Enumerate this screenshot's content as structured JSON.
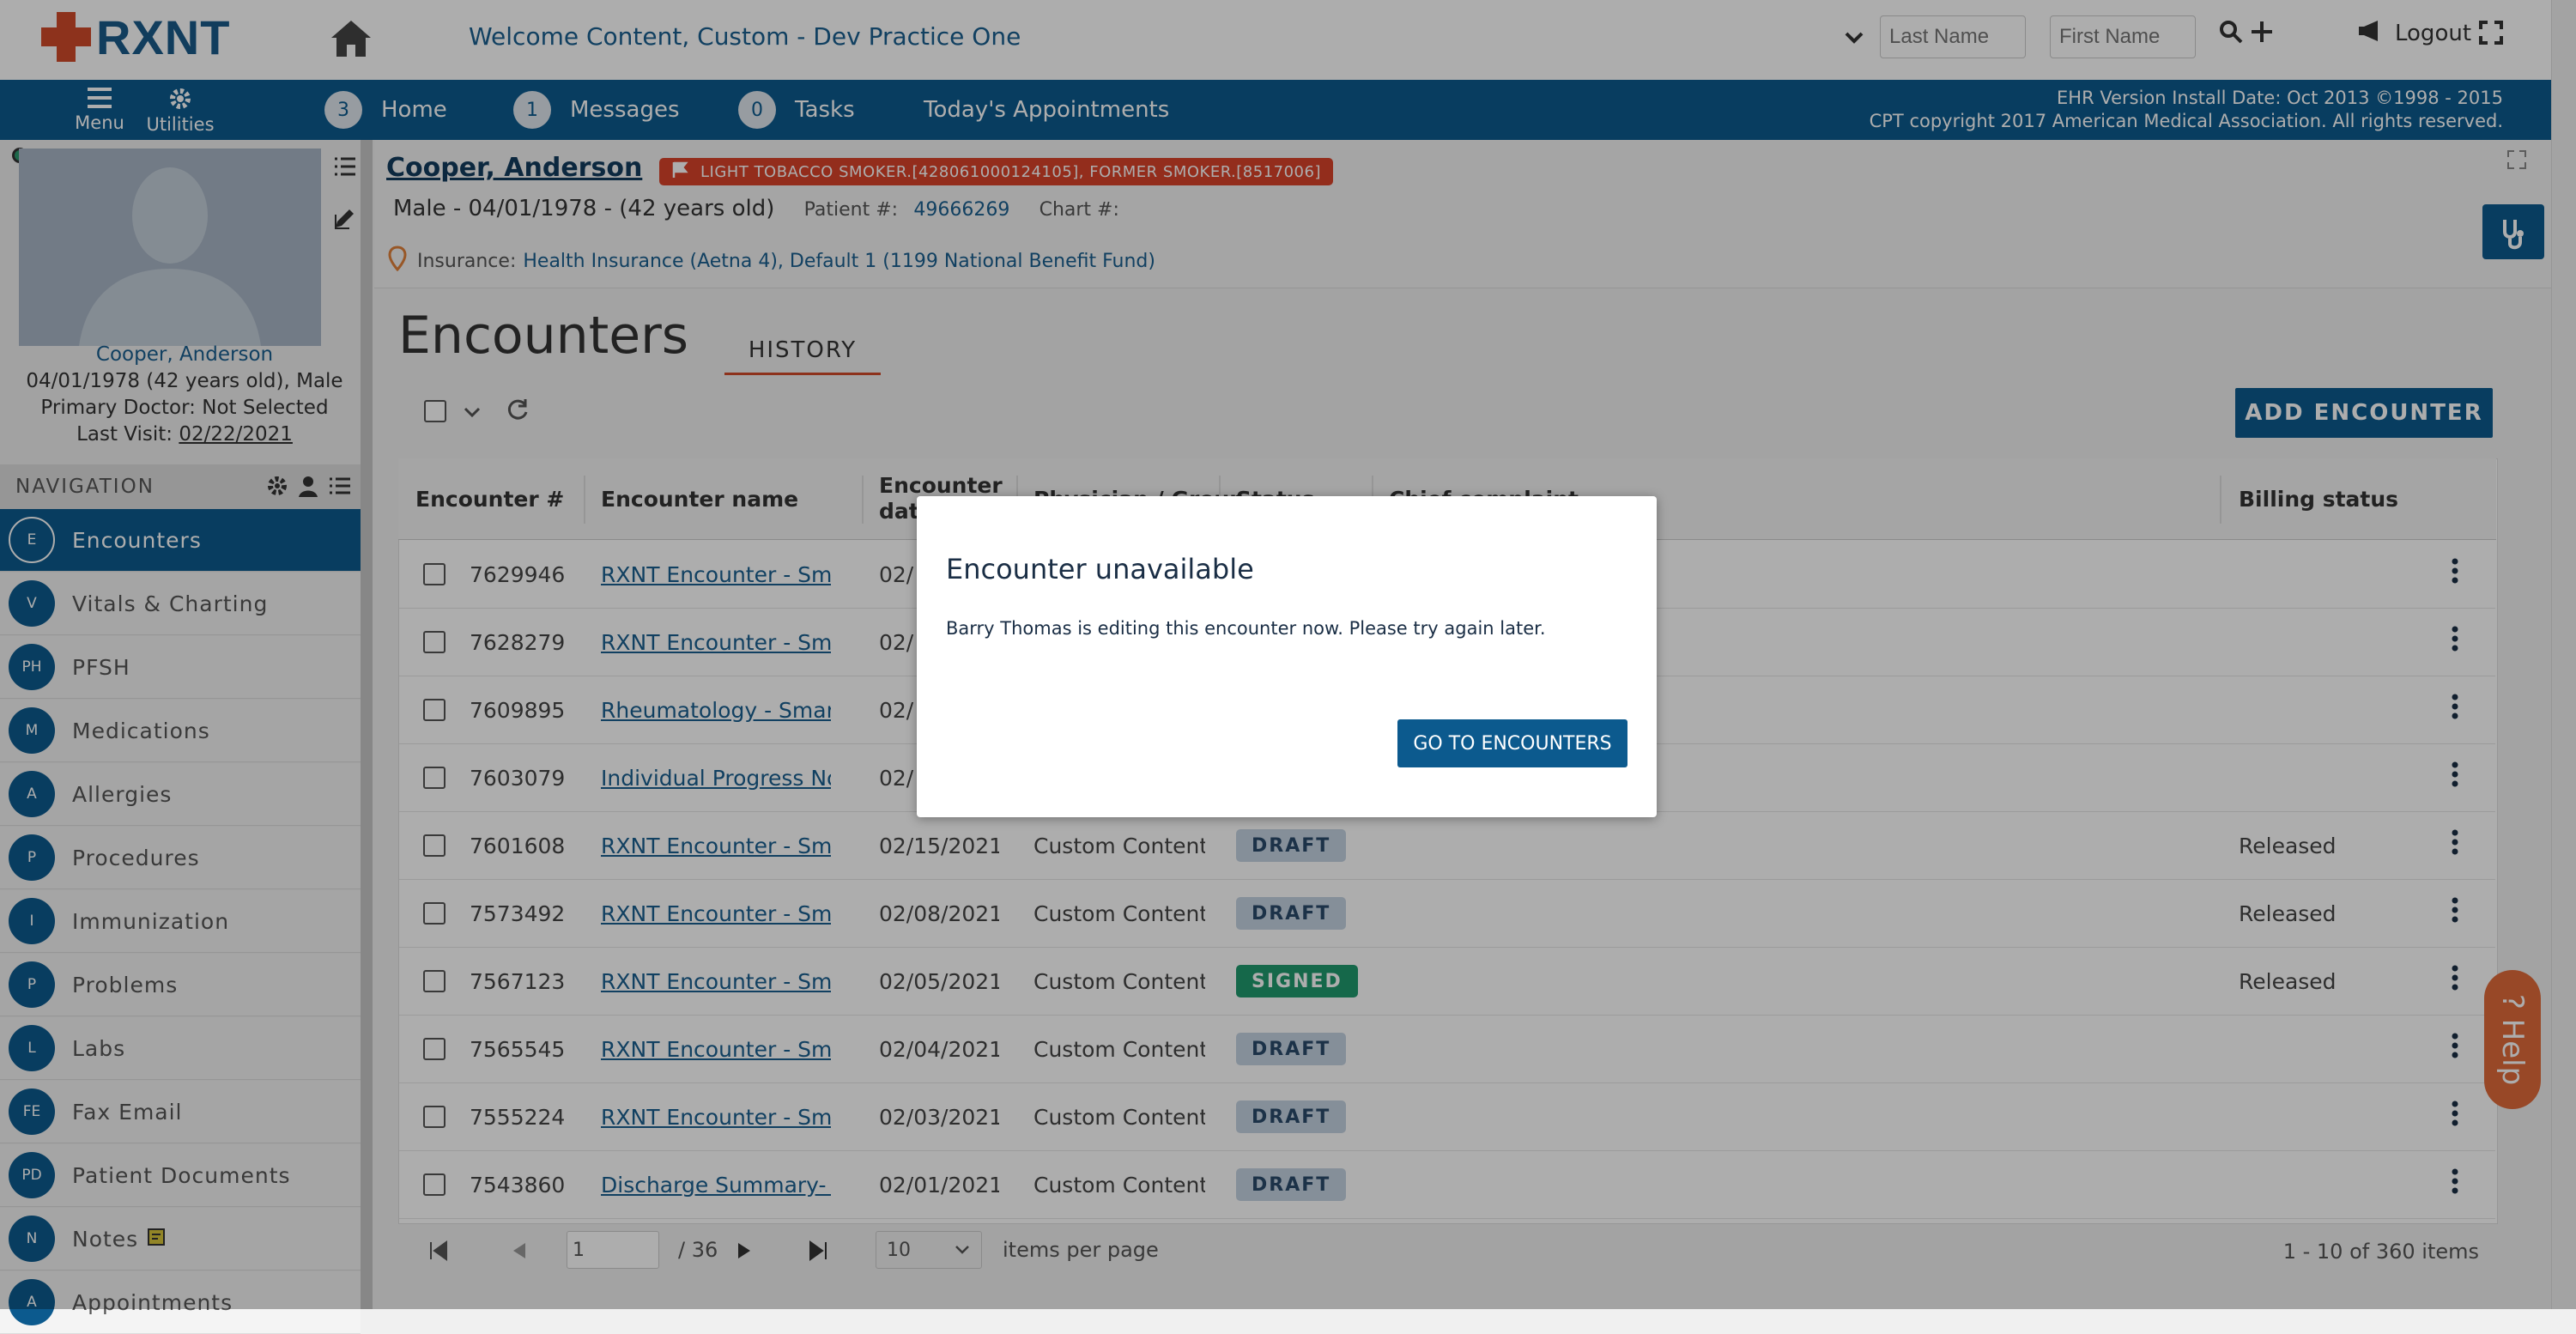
{
  "brand": {
    "name": "RXNT",
    "cross_color": "#d04a2a",
    "text_color": "#1a5a8a"
  },
  "header": {
    "welcome": "Welcome  Content, Custom - Dev Practice One",
    "last_name_placeholder": "Last Name",
    "first_name_placeholder": "First Name",
    "logout": "Logout"
  },
  "navbar": {
    "menu": "Menu",
    "utilities": "Utilities",
    "home_count": "3",
    "home": "Home",
    "messages_count": "1",
    "messages": "Messages",
    "tasks_count": "0",
    "tasks": "Tasks",
    "appointments": "Today's Appointments",
    "ehr_line1": "EHR Version Install Date: Oct 2013 ©1998 - 2015",
    "ehr_line2": "CPT copyright 2017 American Medical Association. All rights reserved."
  },
  "patient": {
    "name": "Cooper, Anderson",
    "dob_line": "04/01/1978 (42 years old), Male",
    "primary_doctor": "Primary Doctor: Not Selected",
    "last_visit_label": "Last Visit:",
    "last_visit": "02/22/2021",
    "header_name": "Cooper, Anderson",
    "flag": "LIGHT TOBACCO SMOKER.[428061000124105], FORMER SMOKER.[8517006]",
    "detail": "Male - 04/01/1978 - (42 years old)",
    "patient_num_label": "Patient #:",
    "patient_num": "49666269",
    "chart_label": "Chart #:",
    "insurance_label": "Insurance:",
    "insurance": "Health Insurance (Aetna 4), Default 1 (1199 National Benefit Fund)"
  },
  "navigation": {
    "title": "NAVIGATION",
    "items": [
      {
        "abbr": "E",
        "label": "Encounters"
      },
      {
        "abbr": "V",
        "label": "Vitals & Charting"
      },
      {
        "abbr": "PH",
        "label": "PFSH"
      },
      {
        "abbr": "M",
        "label": "Medications"
      },
      {
        "abbr": "A",
        "label": "Allergies"
      },
      {
        "abbr": "P",
        "label": "Procedures"
      },
      {
        "abbr": "I",
        "label": "Immunization"
      },
      {
        "abbr": "P",
        "label": "Problems"
      },
      {
        "abbr": "L",
        "label": "Labs"
      },
      {
        "abbr": "FE",
        "label": "Fax Email"
      },
      {
        "abbr": "PD",
        "label": "Patient Documents"
      },
      {
        "abbr": "N",
        "label": "Notes"
      },
      {
        "abbr": "A",
        "label": "Appointments"
      }
    ]
  },
  "main": {
    "title": "Encounters",
    "history_tab": "HISTORY",
    "add_button": "ADD ENCOUNTER",
    "columns": [
      "Encounter #",
      "Encounter name",
      "Encounter dat",
      "Physician / Group",
      "Status",
      "Chief complaint",
      "Billing status"
    ],
    "rows": [
      {
        "num": "7629946",
        "name": "RXNT Encounter - Smart For",
        "date": "02/",
        "group": "",
        "status": "",
        "billing": ""
      },
      {
        "num": "7628279",
        "name": "RXNT Encounter - Smart For",
        "date": "02/",
        "group": "",
        "status": "",
        "billing": ""
      },
      {
        "num": "7609895",
        "name": "Rheumatology - Smart Form",
        "date": "02/",
        "group": "",
        "status": "",
        "billing": ""
      },
      {
        "num": "7603079",
        "name": "Individual Progress Note - K",
        "date": "02/",
        "group": "",
        "status": "",
        "billing": ""
      },
      {
        "num": "7601608",
        "name": "RXNT Encounter - Smart For",
        "date": "02/15/2021",
        "group": "Custom Content",
        "status": "DRAFT",
        "billing": "Released"
      },
      {
        "num": "7573492",
        "name": "RXNT Encounter - Smart For",
        "date": "02/08/2021",
        "group": "Custom Content",
        "status": "DRAFT",
        "billing": "Released"
      },
      {
        "num": "7567123",
        "name": "RXNT Encounter - Smart For",
        "date": "02/05/2021",
        "group": "Custom Content",
        "status": "SIGNED",
        "billing": "Released"
      },
      {
        "num": "7565545",
        "name": "RXNT Encounter - Smart For",
        "date": "02/04/2021",
        "group": "Custom Content",
        "status": "DRAFT",
        "billing": ""
      },
      {
        "num": "7555224",
        "name": "RXNT Encounter - Smart For",
        "date": "02/03/2021",
        "group": "Custom Content",
        "status": "DRAFT",
        "billing": ""
      },
      {
        "num": "7543860",
        "name": "Discharge Summary- KH - S",
        "date": "02/01/2021",
        "group": "Custom Content",
        "status": "DRAFT",
        "billing": ""
      }
    ],
    "pager": {
      "page": "1",
      "total": "/ 36",
      "per_page": "10",
      "per_page_label": "items per page",
      "summary": "1 - 10 of 360 items"
    }
  },
  "modal": {
    "title": "Encounter unavailable",
    "message": "Barry Thomas is editing this encounter now. Please try again later.",
    "button": "GO TO ENCOUNTERS"
  },
  "help": {
    "label": "? Help"
  },
  "colors": {
    "primary": "#0c5a8e",
    "accent": "#d04a2a",
    "signed": "#1f9a6e",
    "draft": "#c5d3e2"
  }
}
